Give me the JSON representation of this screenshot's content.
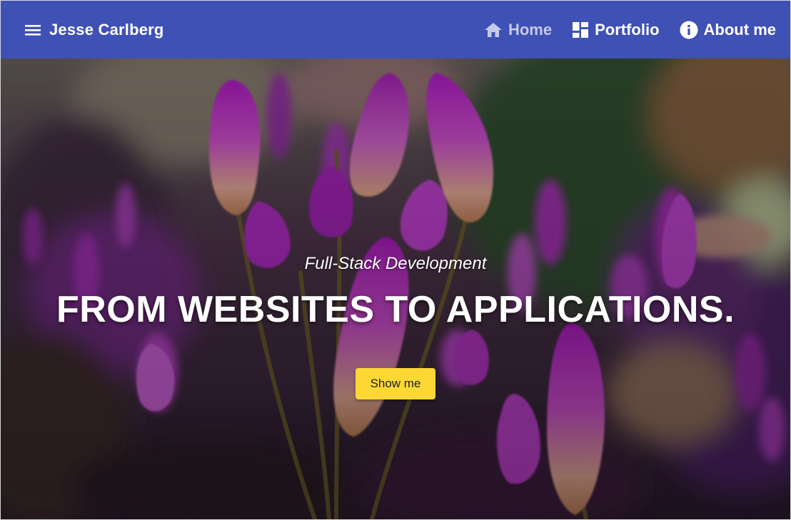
{
  "appbar": {
    "menu_icon": "menu-icon",
    "brand": "Jesse Carlberg",
    "color": "#3f51b5",
    "nav": [
      {
        "label": "Home",
        "icon": "home-icon",
        "active": true
      },
      {
        "label": "Portfolio",
        "icon": "dashboard-icon",
        "active": false
      },
      {
        "label": "About me",
        "icon": "info-icon",
        "active": false
      }
    ]
  },
  "hero": {
    "subtitle": "Full-Stack Development",
    "headline": "FROM WEBSITES TO APPLICATIONS.",
    "cta_label": "Show me",
    "cta_color": "#fdd835",
    "background": "purple-flowers-photo"
  }
}
